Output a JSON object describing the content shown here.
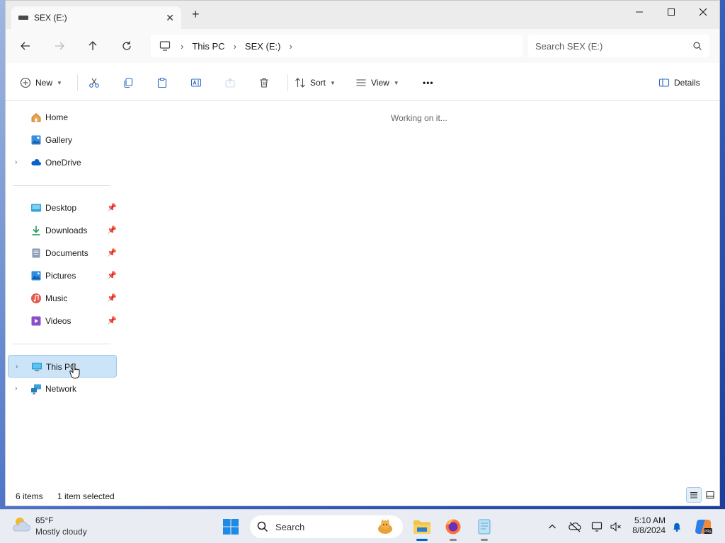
{
  "window": {
    "tab_title": "SEX (E:)",
    "new_tab_symbol": "+"
  },
  "address": {
    "crumbs": [
      "This PC",
      "SEX (E:)"
    ],
    "search_placeholder": "Search SEX (E:)"
  },
  "toolbar": {
    "new_label": "New",
    "sort_label": "Sort",
    "view_label": "View",
    "more_label": "•••",
    "details_label": "Details"
  },
  "sidebar": {
    "items": [
      {
        "label": "Home"
      },
      {
        "label": "Gallery"
      },
      {
        "label": "OneDrive"
      },
      {
        "label": "Desktop"
      },
      {
        "label": "Downloads"
      },
      {
        "label": "Documents"
      },
      {
        "label": "Pictures"
      },
      {
        "label": "Music"
      },
      {
        "label": "Videos"
      },
      {
        "label": "This PC"
      },
      {
        "label": "Network"
      }
    ]
  },
  "content": {
    "status_message": "Working on it..."
  },
  "statusbar": {
    "item_count": "6 items",
    "selection": "1 item selected"
  },
  "taskbar": {
    "weather_temp": "65°F",
    "weather_condition": "Mostly cloudy",
    "search_label": "Search",
    "time": "5:10 AM",
    "date": "8/8/2024"
  },
  "colors": {
    "accent": "#0067c0",
    "selection": "#cce4f7"
  }
}
